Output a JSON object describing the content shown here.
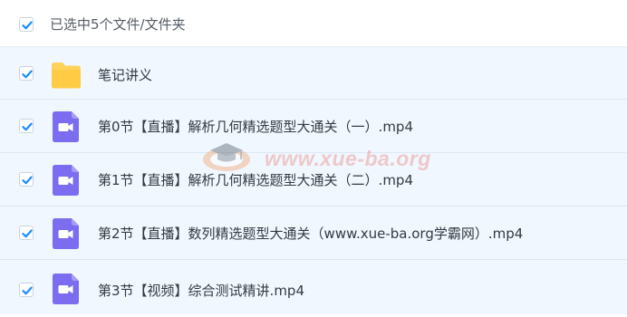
{
  "selection": {
    "summary": "已选中5个文件/文件夹",
    "all_checked": true
  },
  "files": [
    {
      "name": "笔记讲义",
      "type": "folder",
      "icon": "folder-icon",
      "checked": true
    },
    {
      "name": "第0节【直播】解析几何精选题型大通关（一）.mp4",
      "type": "video",
      "icon": "video-file-icon",
      "checked": true
    },
    {
      "name": "第1节【直播】解析几何精选题型大通关（二）.mp4",
      "type": "video",
      "icon": "video-file-icon",
      "checked": true
    },
    {
      "name": "第2节【直播】数列精选题型大通关（www.xue-ba.org学霸网）.mp4",
      "type": "video",
      "icon": "video-file-icon",
      "checked": true
    },
    {
      "name": "第3节【视频】综合测试精讲.mp4",
      "type": "video",
      "icon": "video-file-icon",
      "checked": true
    }
  ],
  "watermark": {
    "text": "www.xue-ba.org",
    "icon": "graduation-cap-icon"
  },
  "colors": {
    "checkbox_check": "#1a8cff",
    "folder": "#ffd25a",
    "video": "#7b6cf0",
    "row_background": "#f0f7ff"
  }
}
